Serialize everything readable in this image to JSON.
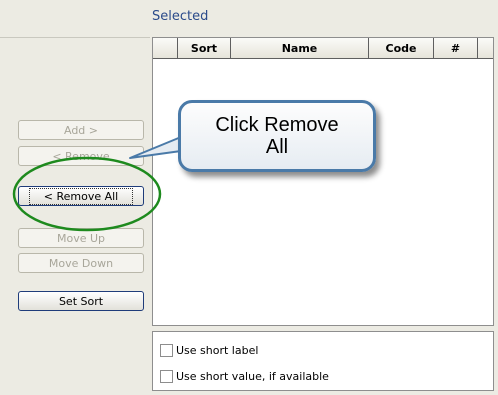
{
  "selected": {
    "title": "Selected",
    "columns": [
      "",
      "Sort",
      "Name",
      "Code",
      "#"
    ]
  },
  "buttons": {
    "add": "Add >",
    "remove": "< Remove",
    "remove_all": "< Remove All",
    "move_up": "Move Up",
    "move_down": "Move Down",
    "set_sort": "Set Sort"
  },
  "options": {
    "short_label": "Use short label",
    "short_value": "Use short value, if available"
  },
  "callout": {
    "text": "Click Remove All"
  },
  "colors": {
    "highlight_ring": "#1e8a1e",
    "callout_border": "#4a7aa8",
    "title_blue": "#2a4a8a"
  }
}
